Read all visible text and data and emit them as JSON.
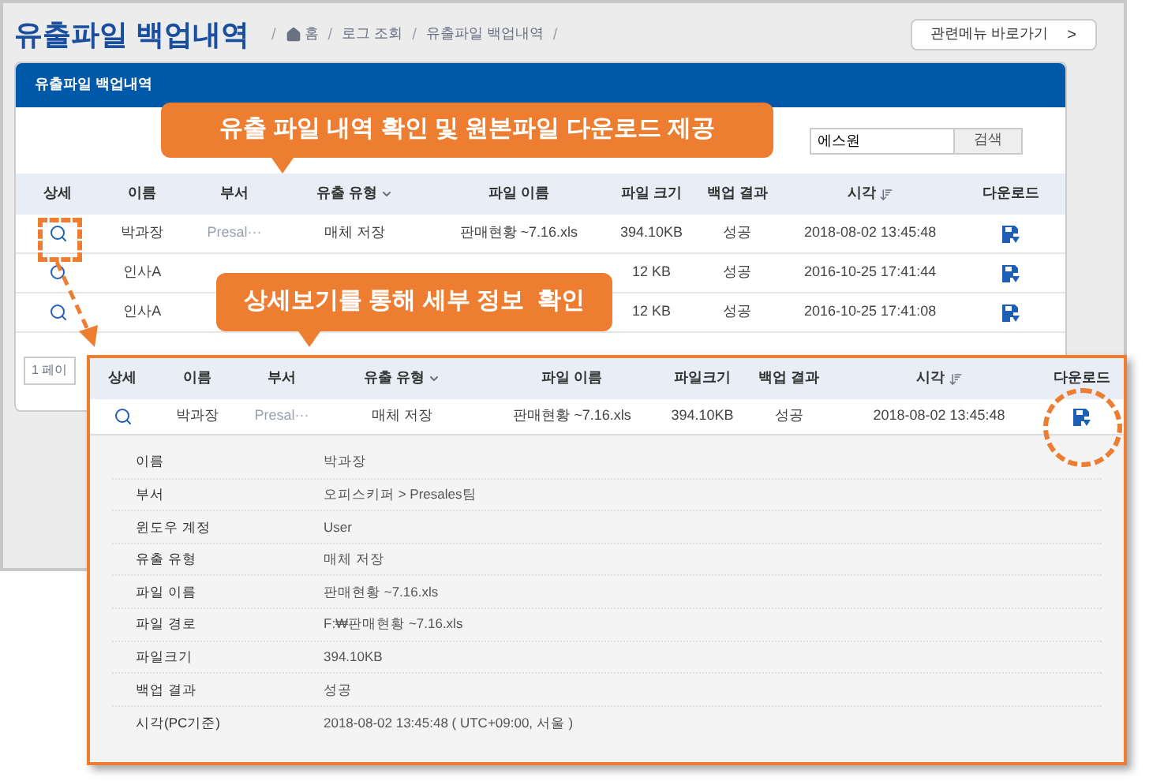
{
  "page": {
    "title": "유출파일 백업내역",
    "breadcrumb": [
      "홈",
      "로그 조회",
      "유출파일 백업내역"
    ],
    "separator": "/",
    "related_button": "관련메뉴 바로가기",
    "related_chevron": ">"
  },
  "panel": {
    "title": "유출파일 백업내역",
    "search": {
      "value": "에스원"
    },
    "search_button": "검색",
    "columns": [
      {
        "label": "상세",
        "kind": "plain"
      },
      {
        "label": "이름",
        "kind": "plain"
      },
      {
        "label": "부서",
        "kind": "plain"
      },
      {
        "label": "유출 유형",
        "kind": "dropdown"
      },
      {
        "label": "파일 이름",
        "kind": "plain"
      },
      {
        "label": "파일 크기",
        "kind": "plain"
      },
      {
        "label": "백업 결과",
        "kind": "plain"
      },
      {
        "label": "시각",
        "kind": "sort"
      },
      {
        "label": "다운로드",
        "kind": "plain"
      }
    ],
    "rows": [
      {
        "name": "박과장",
        "dept": "Presal···",
        "type": "매체 저장",
        "file": "판매현황 ~7.16.xls",
        "size": "394.10KB",
        "result": "성공",
        "time": "2018-08-02 13:45:48"
      },
      {
        "name": "인사A",
        "size": "12 KB",
        "result": "성공",
        "time": "2016-10-25 17:41:44"
      },
      {
        "name": "인사A",
        "size": "12 KB",
        "result": "성공",
        "time": "2016-10-25 17:41:08"
      }
    ],
    "pagination": "1 페이"
  },
  "callouts": [
    "유출 파일 내역 확인 및 원본파일 다운로드 제공",
    "상세보기를 통해 세부 정보  확인"
  ],
  "detail": {
    "columns": [
      {
        "label": "상세",
        "kind": "plain"
      },
      {
        "label": "이름",
        "kind": "plain"
      },
      {
        "label": "부서",
        "kind": "plain"
      },
      {
        "label": "유출 유형",
        "kind": "dropdown"
      },
      {
        "label": "파일 이름",
        "kind": "plain"
      },
      {
        "label": "파일크기",
        "kind": "plain"
      },
      {
        "label": "백업 결과",
        "kind": "plain"
      },
      {
        "label": "시각",
        "kind": "sort"
      },
      {
        "label": "다운로드",
        "kind": "plain"
      }
    ],
    "row": {
      "name": "박과장",
      "dept": "Presal···",
      "type": "매체 저장",
      "file": "판매현황 ~7.16.xls",
      "size": "394.10KB",
      "result": "성공",
      "time": "2018-08-02 13:45:48"
    },
    "fields": [
      {
        "label": "이름",
        "value": "박과장"
      },
      {
        "label": "부서",
        "value": "오피스키퍼 > Presales팀"
      },
      {
        "label": "윈도우 계정",
        "value": "User"
      },
      {
        "label": "유출 유형",
        "value": "매체 저장"
      },
      {
        "label": "파일 이름",
        "value": "판매현황 ~7.16.xls"
      },
      {
        "label": "파일 경로",
        "value": "F:₩판매현황 ~7.16.xls"
      },
      {
        "label": "파일크기",
        "value": "394.10KB"
      },
      {
        "label": "백업 결과",
        "value": "성공"
      },
      {
        "label": "시각(PC기준)",
        "value": "2018-08-02 13:45:48 ( UTC+09:00, 서울 )"
      }
    ]
  }
}
